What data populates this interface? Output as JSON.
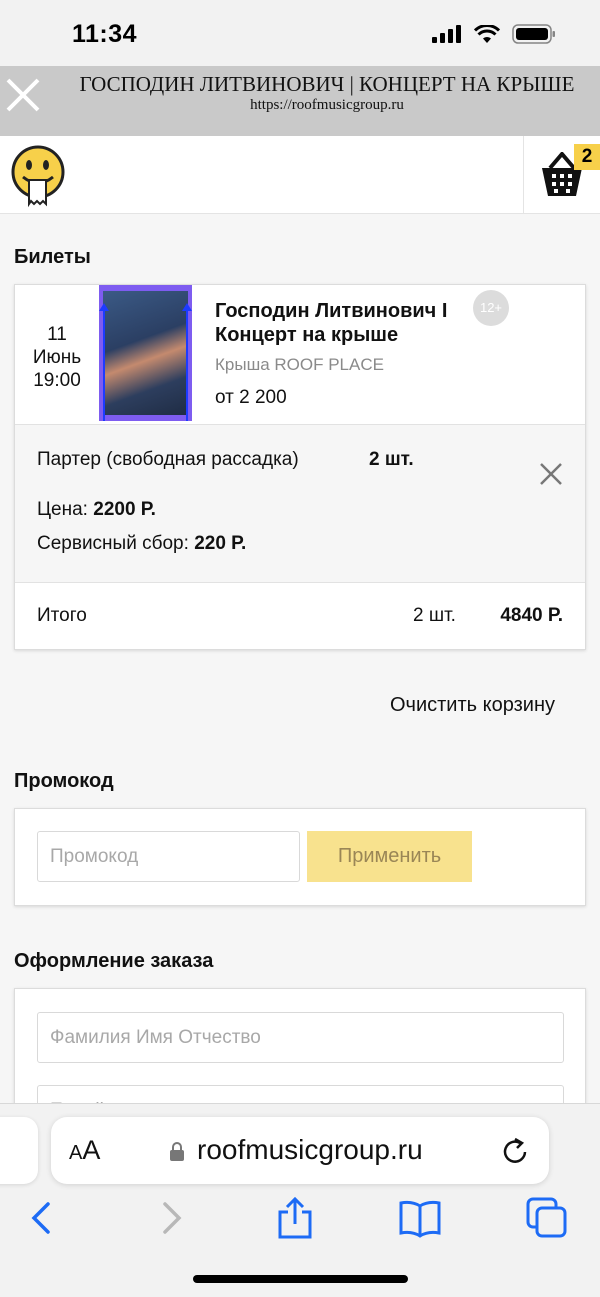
{
  "status_bar": {
    "time": "11:34"
  },
  "webview": {
    "title": "ГОСПОДИН ЛИТВИНОВИЧ | КОНЦЕРТ НА КРЫШЕ",
    "url": "https://roofmusicgroup.ru"
  },
  "header": {
    "cart_count": "2"
  },
  "tickets": {
    "section_title": "Билеты",
    "event": {
      "day": "11",
      "month": "Июнь",
      "time": "19:00",
      "title_line1": "Господин Литвинович I",
      "title_line2": "Концерт на крыше",
      "age": "12+",
      "venue": "Крыша ROOF PLACE",
      "price_from": "от 2 200"
    },
    "item": {
      "type": "Партер (свободная рассадка)",
      "qty": "2 шт.",
      "price_label": "Цена:",
      "price_value": "2200 Р.",
      "fee_label": "Сервисный сбор:",
      "fee_value": "220 Р."
    },
    "total": {
      "label": "Итого",
      "qty": "2 шт.",
      "sum": "4840 Р."
    },
    "clear_cart": "Очистить корзину"
  },
  "promo": {
    "section_title": "Промокод",
    "placeholder": "Промокод",
    "apply_label": "Применить"
  },
  "order": {
    "section_title": "Оформление заказа",
    "name_placeholder": "Фамилия Имя Отчество",
    "email_placeholder": "E-mail"
  },
  "safari": {
    "aa_small": "A",
    "aa_large": "A",
    "url": "roofmusicgroup.ru"
  },
  "colors": {
    "accent_yellow": "#f7d04a",
    "apply_button": "#f8e28e",
    "thumb_frame": "#7e5cf0"
  }
}
